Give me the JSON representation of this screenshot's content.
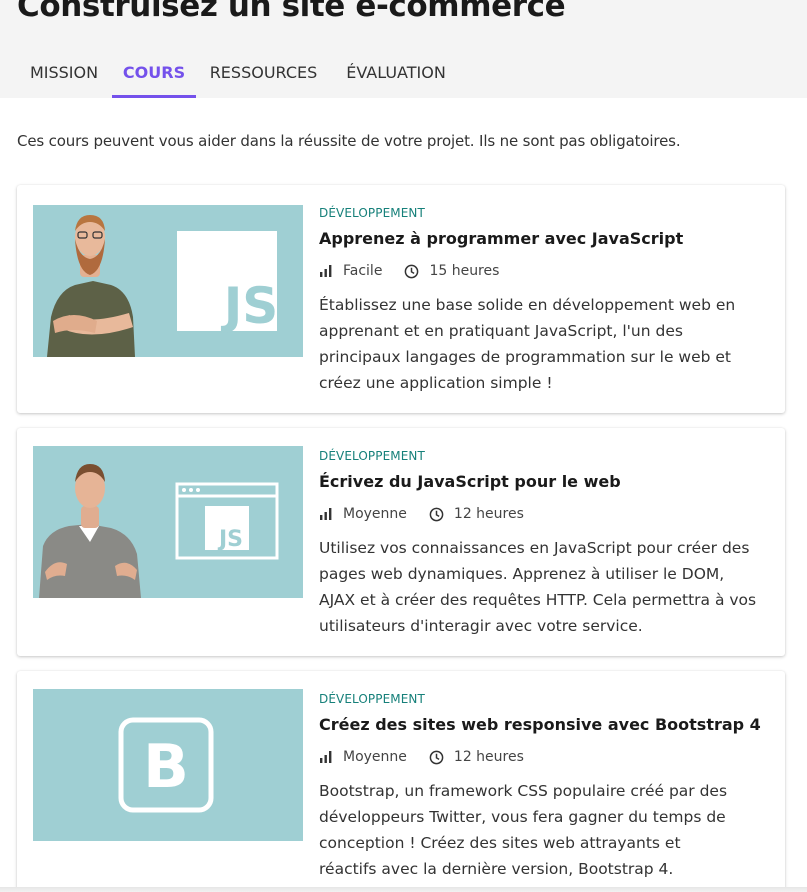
{
  "page": {
    "title": "Construisez un site e-commerce",
    "intro": "Ces cours peuvent vous aider dans la réussite de votre projet. Ils ne sont pas obligatoires."
  },
  "tabs": [
    {
      "label": "MISSION",
      "active": false
    },
    {
      "label": "COURS",
      "active": true
    },
    {
      "label": "RESSOURCES",
      "active": false
    },
    {
      "label": "ÉVALUATION",
      "active": false
    }
  ],
  "courses": [
    {
      "category": "DÉVELOPPEMENT",
      "title": "Apprenez à programmer avec JavaScript",
      "difficulty": "Facile",
      "duration": "15 heures",
      "description_lines": [
        "Établissez une base solide en développement web en",
        "apprenant et en pratiquant JavaScript, l'un des",
        "principaux langages de programmation sur le web et",
        "créez une application simple !"
      ],
      "thumb_label": "JS"
    },
    {
      "category": "DÉVELOPPEMENT",
      "title": "Écrivez du JavaScript pour le web",
      "difficulty": "Moyenne",
      "duration": "12 heures",
      "description_lines": [
        "Utilisez vos connaissances en JavaScript pour créer des",
        "pages web dynamiques. Apprenez à utiliser le DOM,",
        "AJAX et à créer des requêtes HTTP. Cela permettra à vos",
        "utilisateurs d'interagir avec votre service."
      ],
      "thumb_label": "JS"
    },
    {
      "category": "DÉVELOPPEMENT",
      "title": "Créez des sites web responsive avec Bootstrap 4",
      "difficulty": "Moyenne",
      "duration": "12 heures",
      "description_lines": [
        "Bootstrap, un framework CSS populaire créé par des",
        "développeurs Twitter, vous fera gagner du temps de",
        "conception ! Créez des sites web attrayants et",
        "réactifs avec la dernière version, Bootstrap 4."
      ],
      "thumb_label": "B"
    }
  ],
  "colors": {
    "accent": "#7451eb",
    "category": "#16807a",
    "thumb_bg": "#9fcfd3",
    "header_bg": "#f4f4f4"
  },
  "icons": {
    "difficulty": "signal-bars-icon",
    "duration": "clock-icon"
  }
}
